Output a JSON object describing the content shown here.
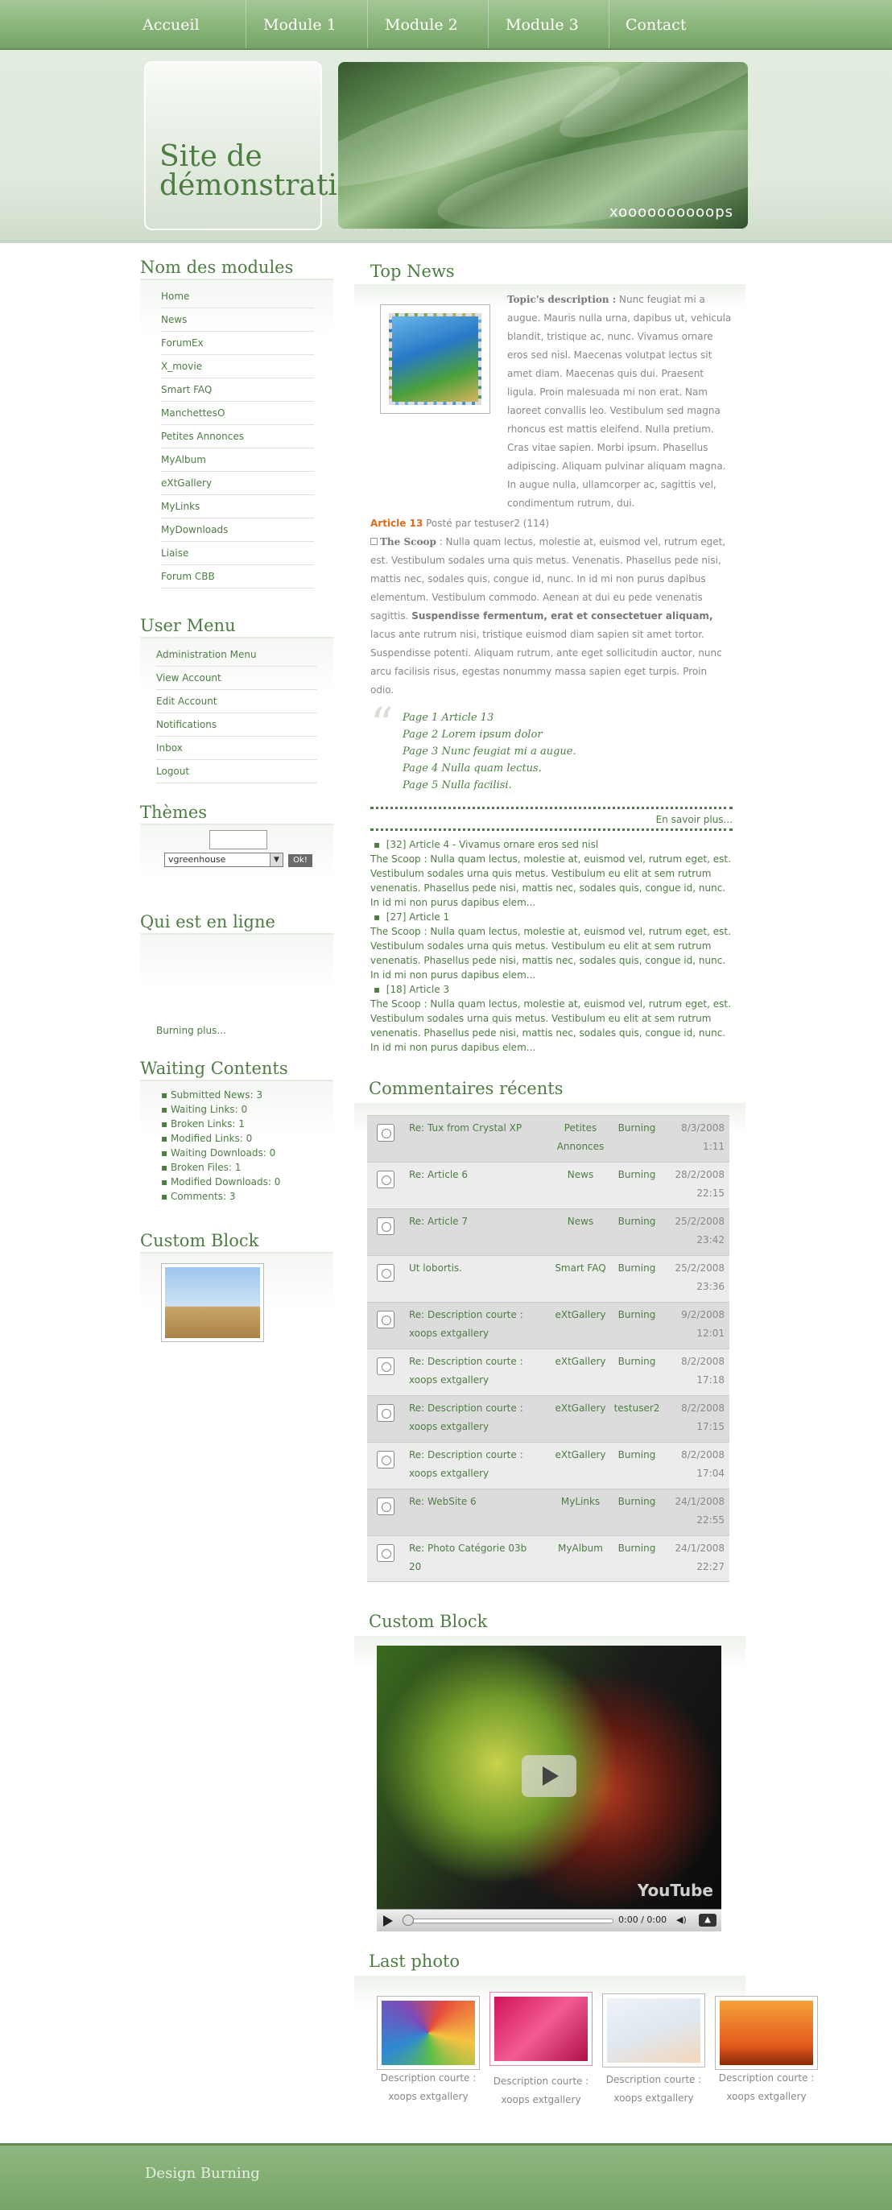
{
  "nav": {
    "items": [
      "Accueil",
      "Module 1",
      "Module 2",
      "Module 3",
      "Contact"
    ]
  },
  "header": {
    "site_title": "Site de démonstration",
    "banner_text": "xoooooooooops"
  },
  "modules": {
    "title": "Nom des modules",
    "items": [
      "Home",
      "News",
      "ForumEx",
      "X_movie",
      "Smart FAQ",
      "ManchettesO",
      "Petites Annonces",
      "MyAlbum",
      "eXtGallery",
      "MyLinks",
      "MyDownloads",
      "Liaise",
      "Forum CBB"
    ]
  },
  "user_menu": {
    "title": "User Menu",
    "items": [
      "Administration Menu",
      "View Account",
      "Edit Account",
      "Notifications",
      "Inbox",
      "Logout"
    ]
  },
  "themes": {
    "title": "Thèmes",
    "selected": "vgreenhouse",
    "ok_label": "Ok!"
  },
  "online": {
    "title": "Qui est en ligne",
    "link": "Burning  plus..."
  },
  "waiting": {
    "title": "Waiting Contents",
    "items": [
      "Submitted News: 3",
      "Waiting Links: 0",
      "Broken Links: 1",
      "Modified Links: 0",
      "Waiting Downloads: 0",
      "Broken Files: 1",
      "Modified Downloads: 0",
      "Comments: 3"
    ]
  },
  "custom_block_left": {
    "title": "Custom Block"
  },
  "top_news": {
    "title": "Top News",
    "topic_label": "Topic's description :",
    "topic_text": " Nunc feugiat mi a augue. Mauris nulla urna, dapibus ut, vehicula blandit, tristique ac, nunc. Vivamus ornare eros sed nisl. Maecenas volutpat lectus sit amet diam. Maecenas quis dui. Praesent ligula. Proin malesuada mi non erat. Nam laoreet convallis leo. Vestibulum sed magna rhoncus est mattis eleifend. Nulla pretium. Cras vitae sapien. Morbi ipsum. Phasellus adipiscing. Aliquam pulvinar aliquam magna. In augue nulla, ullamcorper ac, sagittis vel, condimentum rutrum, dui.",
    "article_link": "Article 13",
    "article_meta": " Posté par testuser2 (114)",
    "scoop_label": "The Scoop",
    "scoop_text_1": " : Nulla quam lectus, molestie at, euismod vel, rutrum eget, est. Vestibulum sodales urna quis metus. Venenatis. Phasellus pede nisi, mattis nec, sodales quis, congue id, nunc. In id mi non purus dapibus elementum. Vestibulum commodo. Aenean at dui eu pede venenatis sagittis. ",
    "scoop_bold": "Suspendisse fermentum, erat et consectetuer aliquam,",
    "scoop_text_2": " lacus ante rutrum nisi, tristique euismod diam sapien sit amet tortor. Suspendisse potenti. Aliquam rutrum, ante eget sollicitudin auctor, nunc arcu facilisis risus, egestas nonummy massa sapien eget turpis. Proin odio.",
    "pages": [
      "Page 1 Article 13",
      "Page 2 Lorem ipsum dolor",
      "Page 3 Nunc feugiat mi a augue.",
      "Page 4 Nulla quam lectus.",
      "Page 5 Nulla facilisi."
    ],
    "read_more": "En savoir plus...",
    "list": [
      {
        "title": "[32] Article 4 - Vivamus ornare eros sed nisl",
        "text": "The Scoop : Nulla quam lectus, molestie at, euismod vel, rutrum eget, est. Vestibulum sodales urna quis metus. Vestibulum eu elit at sem rutrum venenatis. Phasellus pede nisi, mattis nec, sodales quis, congue id, nunc. In id mi non purus dapibus elem..."
      },
      {
        "title": "[27] Article 1",
        "text": "The Scoop : Nulla quam lectus, molestie at, euismod vel, rutrum eget, est. Vestibulum sodales urna quis metus. Vestibulum eu elit at sem rutrum venenatis. Phasellus pede nisi, mattis nec, sodales quis, congue id, nunc. In id mi non purus dapibus elem..."
      },
      {
        "title": "[18] Article 3",
        "text": "The Scoop : Nulla quam lectus, molestie at, euismod vel, rutrum eget, est. Vestibulum sodales urna quis metus. Vestibulum eu elit at sem rutrum venenatis. Phasellus pede nisi, mattis nec, sodales quis, congue id, nunc. In id mi non purus dapibus elem..."
      }
    ]
  },
  "comments": {
    "title": "Commentaires récents",
    "rows": [
      {
        "title": "Re: Tux from Crystal XP",
        "module": "Petites Annonces",
        "user": "Burning",
        "date": "8/3/2008 1:11"
      },
      {
        "title": "Re: Article 6",
        "module": "News",
        "user": "Burning",
        "date": "28/2/2008 22:15"
      },
      {
        "title": "Re: Article 7",
        "module": "News",
        "user": "Burning",
        "date": "25/2/2008 23:42"
      },
      {
        "title": "Ut lobortis.",
        "module": "Smart FAQ",
        "user": "Burning",
        "date": "25/2/2008 23:36"
      },
      {
        "title": "Re: Description courte : xoops extgallery",
        "module": "eXtGallery",
        "user": "Burning",
        "date": "9/2/2008 12:01"
      },
      {
        "title": "Re: Description courte : xoops extgallery",
        "module": "eXtGallery",
        "user": "Burning",
        "date": "8/2/2008 17:18"
      },
      {
        "title": "Re: Description courte : xoops extgallery",
        "module": "eXtGallery",
        "user": "testuser2",
        "date": "8/2/2008 17:15"
      },
      {
        "title": "Re: Description courte : xoops extgallery",
        "module": "eXtGallery",
        "user": "Burning",
        "date": "8/2/2008 17:04"
      },
      {
        "title": "Re: WebSite 6",
        "module": "MyLinks",
        "user": "Burning",
        "date": "24/1/2008 22:55"
      },
      {
        "title": "Re: Photo Catégorie 03b 20",
        "module": "MyAlbum",
        "user": "Burning",
        "date": "24/1/2008 22:27"
      }
    ]
  },
  "custom_block_main": {
    "title": "Custom Block",
    "time": "0:00 / 0:00",
    "brand": "YouTube"
  },
  "last_photo": {
    "title": "Last photo",
    "captions": [
      {
        "line1": "Description courte :",
        "line2": "xoops extgallery"
      },
      {
        "line1": "Description courte :",
        "line2": "xoops extgallery"
      },
      {
        "line1": "Description courte :",
        "line2": "xoops extgallery"
      },
      {
        "line1": "Description courte :",
        "line2": "xoops extgallery"
      }
    ]
  },
  "footer": {
    "text": "Design Burning"
  },
  "colors": {
    "accent_green": "#4e7d44",
    "nav_green": "#8ab57a",
    "link_orange": "#e06b1a"
  }
}
